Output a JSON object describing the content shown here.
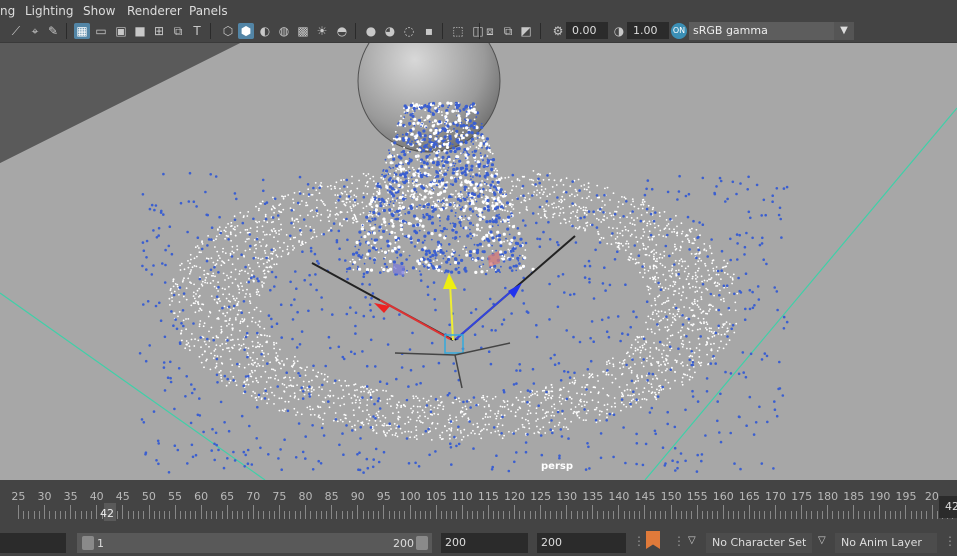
{
  "menubar": {
    "items": [
      "ng",
      "Lighting",
      "Show",
      "Renderer",
      "Panels"
    ]
  },
  "toolbar": {
    "exposure_value": "0.00",
    "gamma_value": "1.00",
    "colorspace": "sRGB gamma",
    "icons": [
      "select-icon",
      "lasso-icon",
      "paint-icon",
      "grid-icon",
      "film-gate-icon",
      "resolution-gate-icon",
      "safe-area-icon",
      "wireframe-icon",
      "smooth-shade-icon",
      "textured-icon",
      "lights-icon",
      "shadows-icon",
      "xray-icon",
      "isolate-icon",
      "camera-icon",
      "exposure-icon",
      "gamma-icon",
      "color-management-icon"
    ]
  },
  "viewport": {
    "camera_label": "persp",
    "colors": {
      "ground": "#a7a7a7",
      "background": "#5f5f5f",
      "grid_line": "#3fd0a8",
      "particle_blue": "#3b5fd0"
    }
  },
  "timeline": {
    "ticks": [
      "25",
      "30",
      "35",
      "40",
      "45",
      "50",
      "55",
      "60",
      "65",
      "70",
      "75",
      "80",
      "85",
      "90",
      "95",
      "100",
      "105",
      "110",
      "115",
      "120",
      "125",
      "130",
      "135",
      "140",
      "145",
      "150",
      "155",
      "160",
      "165",
      "170",
      "175",
      "180",
      "185",
      "190",
      "195",
      "20"
    ],
    "current_frame": "42",
    "right_frame": "42"
  },
  "range": {
    "start_field": "",
    "range_start": "1",
    "range_end": "200",
    "anim_end": "200",
    "playback_end": "200",
    "character_set": "No Character Set",
    "anim_layer": "No Anim Layer"
  }
}
